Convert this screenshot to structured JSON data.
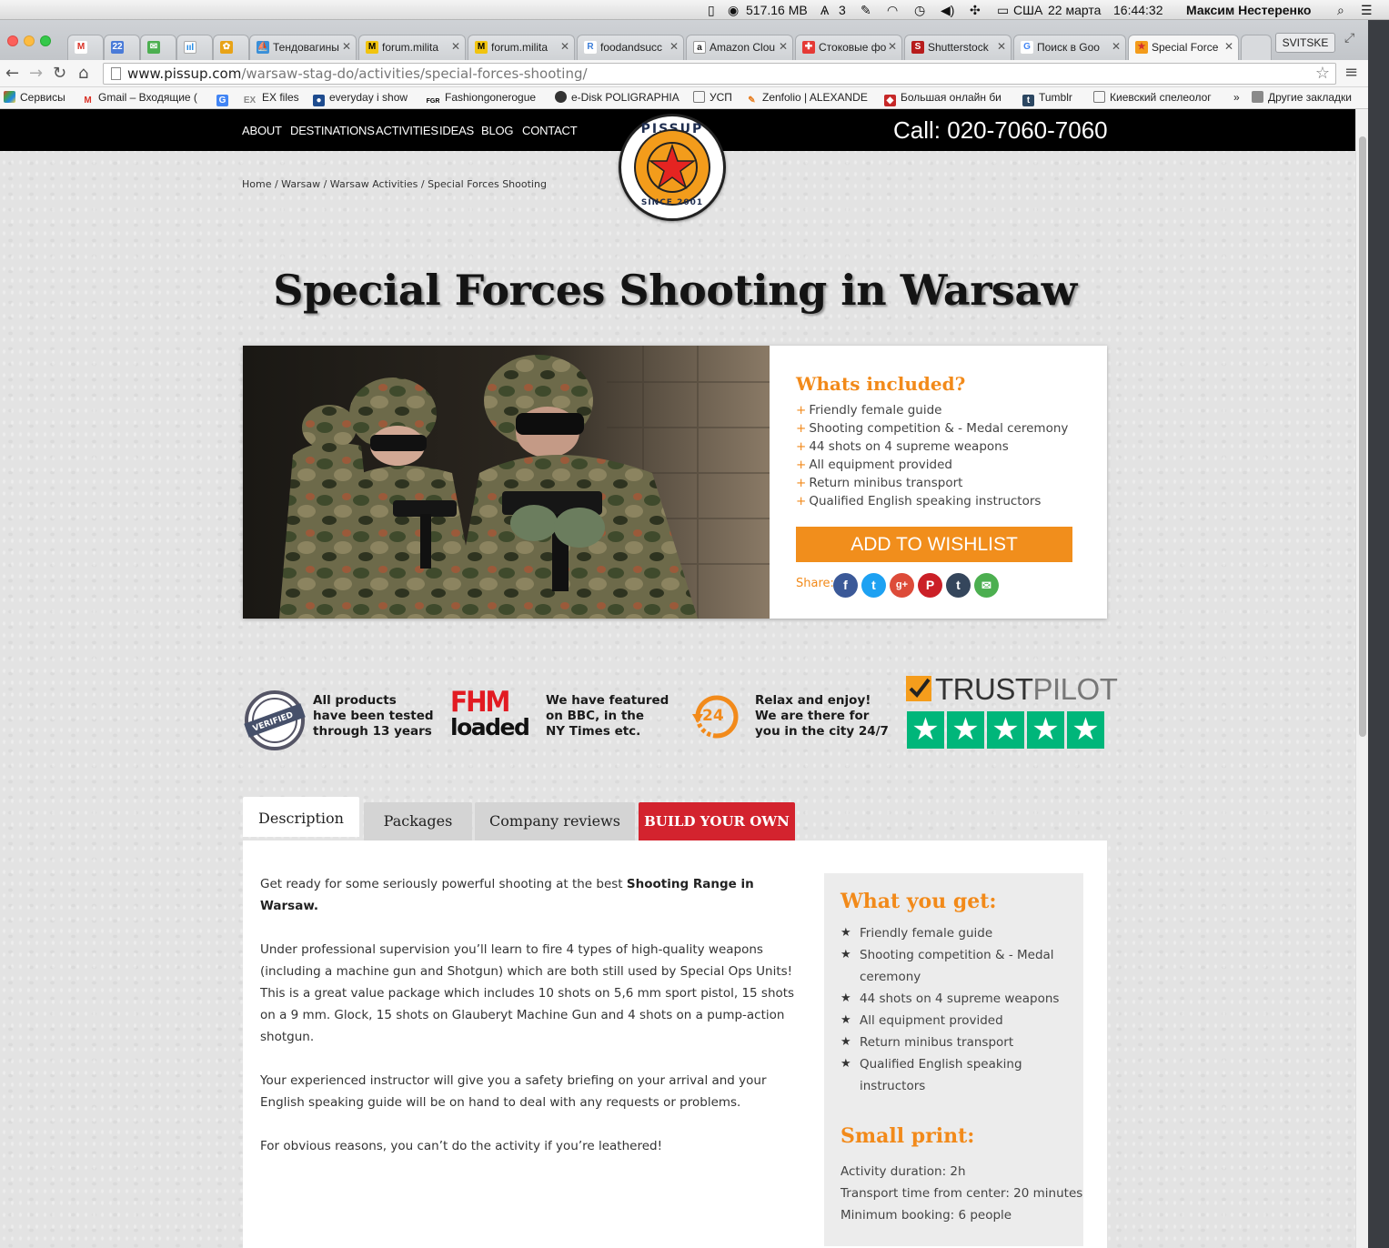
{
  "menubar": {
    "memory": "517.16 MB",
    "count": "3",
    "locale": "США",
    "date": "22 марта",
    "time": "16:44:32",
    "user": "Максим Нестеренко"
  },
  "browser": {
    "tabs": [
      {
        "title": "",
        "icon": "gmail-icon"
      },
      {
        "title": "",
        "icon": "calendar-icon"
      },
      {
        "title": "",
        "icon": "mail-icon"
      },
      {
        "title": "",
        "icon": "analytics-icon"
      },
      {
        "title": "",
        "icon": "photos-icon"
      },
      {
        "title": "Тендовагины",
        "icon": "tender-icon"
      },
      {
        "title": "forum.milita",
        "icon": "forum-icon"
      },
      {
        "title": "forum.milita",
        "icon": "forum-icon"
      },
      {
        "title": "foodandsucc",
        "icon": "food-icon"
      },
      {
        "title": "Amazon Clou",
        "icon": "amazon-icon"
      },
      {
        "title": "Стоковые фо",
        "icon": "stock-icon"
      },
      {
        "title": "Shutterstock",
        "icon": "shutterstock-icon"
      },
      {
        "title": "Поиск в Goo",
        "icon": "google-icon"
      },
      {
        "title": "Special Force",
        "icon": "pissup-icon"
      }
    ],
    "profile": "SVITSKE",
    "url_host": "www.pissup.com",
    "url_path": "/warsaw-stag-do/activities/special-forces-shooting/",
    "bookmarks": [
      {
        "label": "Сервисы"
      },
      {
        "label": "Gmail – Входящие ("
      },
      {
        "label": ""
      },
      {
        "label": "EX files"
      },
      {
        "label": "everyday i show"
      },
      {
        "label": "Fashiongonerogue"
      },
      {
        "label": "e-Disk POLIGRAPHIA"
      },
      {
        "label": "УСП"
      },
      {
        "label": "Zenfolio | ALEXANDE"
      },
      {
        "label": "Большая онлайн би"
      },
      {
        "label": "Tumblr"
      },
      {
        "label": "Киевский спелеолог"
      },
      {
        "label": "»"
      },
      {
        "label": "Другие закладки"
      }
    ]
  },
  "site": {
    "nav": [
      "ABOUT",
      "DESTINATIONS",
      "ACTIVITIES",
      "IDEAS",
      "BLOG",
      "CONTACT"
    ],
    "call": "Call: 020-7060-7060",
    "logo_top": "PISSUP",
    "logo_bottom": "SINCE 2001",
    "breadcrumb": "Home / Warsaw / Warsaw Activities / Special Forces Shooting",
    "title": "Special Forces Shooting in Warsaw",
    "included": {
      "heading": "Whats included?",
      "items": [
        "Friendly female guide",
        "Shooting competition & - Medal ceremony",
        "44 shots on 4 supreme weapons",
        "All equipment provided",
        "Return minibus transport",
        "Qualified English speaking instructors"
      ],
      "wishlist": "ADD TO WISHLIST",
      "share": "Share:"
    },
    "trust": {
      "verified_badge": "VERIFIED",
      "verified": [
        "All products",
        "have been tested",
        "through 13 years"
      ],
      "fhm_top": "FHM",
      "fhm_bottom": "loaded",
      "featured": [
        "We have featured",
        "on BBC, in the",
        "NY Times etc."
      ],
      "badge_24": "24",
      "relax": [
        "Relax and enjoy!",
        "We are there for",
        "you in the city 24/7"
      ],
      "trustpilot_a": "TRUST",
      "trustpilot_b": "PILOT"
    },
    "tabs": [
      "Description",
      "Packages",
      "Company reviews",
      "BUILD YOUR OWN"
    ],
    "description": {
      "p1_pre": "Get ready for some seriously powerful shooting at the best ",
      "p1_bold": "Shooting Range in Warsaw.",
      "p2": "Under professional supervision you’ll learn to fire 4 types of high-quality weapons (including a machine gun and Shotgun) which are both still used by Special Ops Units! This is a great value package which includes 10 shots on 5,6 mm sport pistol, 15 shots on a 9 mm. Glock, 15 shots on Glauberyt Machine Gun and 4 shots on a pump-action shotgun.",
      "p3": "Your experienced instructor will give you a safety briefing on your arrival and your English speaking guide will be on hand to deal with any requests or problems.",
      "p4": "For obvious reasons, you can’t do the activity if you’re leathered!"
    },
    "what_you_get": {
      "heading": "What you get:",
      "items": [
        "Friendly female guide",
        "Shooting competition & - Medal ceremony",
        "44 shots on 4 supreme weapons",
        "All equipment provided",
        "Return minibus transport",
        "Qualified English speaking instructors"
      ]
    },
    "small_print": {
      "heading": "Small print:",
      "items": [
        "Activity duration: 2h",
        "Transport time from center: 20 minutes",
        "Minimum booking: 6 people"
      ]
    }
  },
  "colors": {
    "accent_orange": "#f28a1a",
    "build_red": "#d3232e",
    "trustpilot_green": "#00b67a"
  }
}
